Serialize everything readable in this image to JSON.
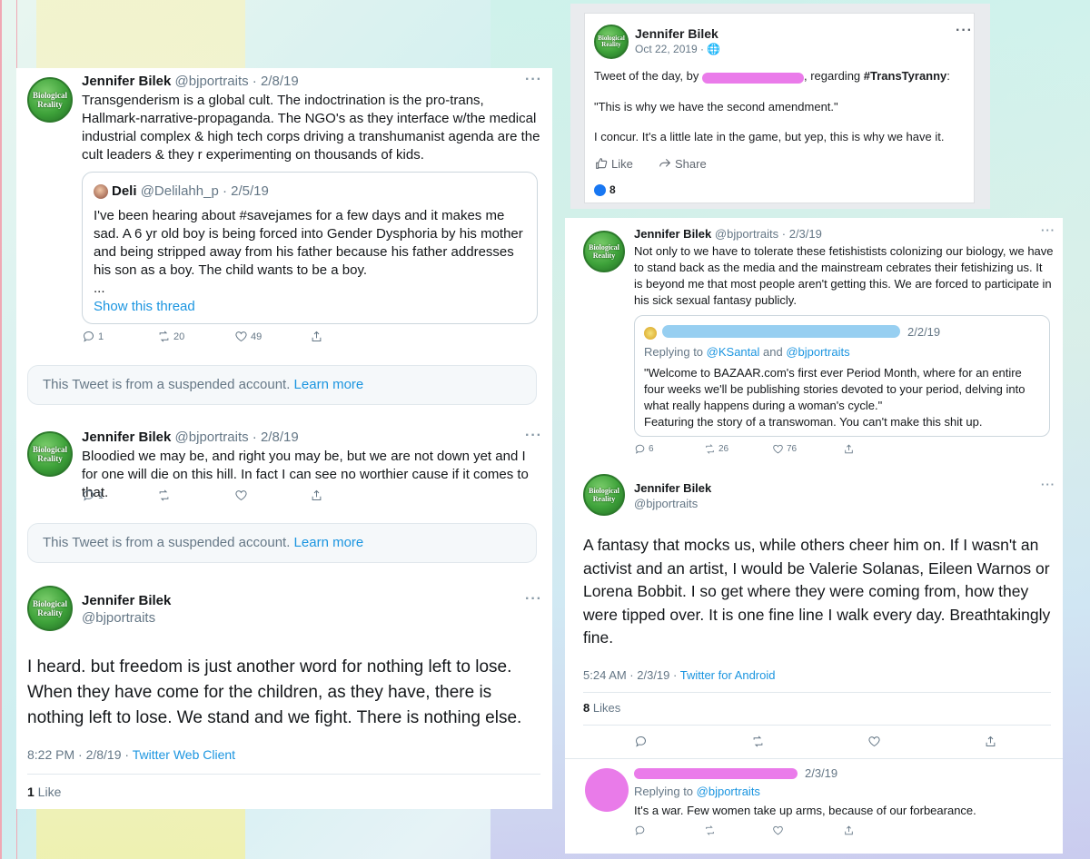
{
  "left": {
    "t1": {
      "name": "Jennifer Bilek",
      "handle": "@bjportraits · 2/8/19",
      "text": "Transgenderism is a global cult.  The indoctrination is the pro-trans, Hallmark-narrative-propaganda.  The NGO's as they interface w/the medical industrial complex & high tech corps driving a transhumanist agenda are the cult leaders & they r experimenting on thousands of kids.",
      "quote": {
        "name": "Deli",
        "handle": "@Delilahh_p · 2/5/19",
        "text": "I've been hearing about #savejames for a few days and it makes me sad. A 6 yr old boy is being forced into Gender Dysphoria by his mother and being stripped away from his father because his father addresses his son as a boy. The child wants to be a boy.",
        "ellipsis": "...",
        "show_thread": "Show this thread"
      },
      "replies": "1",
      "retweets": "20",
      "likes": "49"
    },
    "suspended1": {
      "text": "This Tweet is from a suspended account.",
      "link": "Learn more"
    },
    "t2": {
      "name": "Jennifer Bilek",
      "handle": "@bjportraits · 2/8/19",
      "text": "Bloodied we may be, and right you may be, but we are not down yet and I for one will die on this hill.  In fact I can see no worthier cause if it comes to that.",
      "replies": "1"
    },
    "suspended2": {
      "text": "This Tweet is from a suspended account.",
      "link": "Learn more"
    },
    "t3": {
      "name": "Jennifer Bilek",
      "handle": "@bjportraits",
      "text": "I heard.  but freedom is just another word for nothing left to lose. When they have come for the children, as they have, there is nothing left to lose.  We stand and we fight.  There is nothing else.",
      "time": "8:22 PM · 2/8/19 · ",
      "client": "Twitter Web Client",
      "likes_count": "1",
      "likes_label": " Like"
    }
  },
  "fb": {
    "name": "Jennifer Bilek",
    "date": "Oct 22, 2019 · ",
    "line1_pre": "Tweet of the day, by ",
    "line1_mid": ", regarding ",
    "hashtag": "#TransTyranny",
    "line1_post": ":",
    "quote": "\"This is why we have the second amendment.\"",
    "concur": "I concur.  It's a little late in the game, but yep, this is why we have it.",
    "like": "Like",
    "share": "Share",
    "reactions": "8"
  },
  "right": {
    "t1": {
      "name": "Jennifer Bilek",
      "handle": "@bjportraits · 2/3/19",
      "text": "Not only to we have to tolerate these fetishistists colonizing our biology, we have to stand back as the media and the mainstream cebrates their fetishizing us. It is beyond me that most people aren't getting this. We are forced to participate in his sick sexual fantasy publicly.",
      "quote": {
        "date": "2/2/19",
        "replying": "Replying to ",
        "r1": "@KSantal",
        "and": " and ",
        "r2": "@bjportraits",
        "text": "\"Welcome to BAZAAR.com's first ever Period Month, where for an entire four weeks we'll be publishing stories devoted to your period, delving into what really happens during a woman's cycle.\"",
        "text2": "Featuring the story of a transwoman. You can't make this shit up."
      },
      "replies": "6",
      "retweets": "26",
      "likes": "76"
    },
    "t2": {
      "name": "Jennifer Bilek",
      "handle": "@bjportraits",
      "text": "A fantasy that mocks us, while others cheer him on. If I wasn't an activist and an artist, I would be Valerie Solanas, Eileen Warnos or Lorena Bobbit. I so get where they were coming from, how they were tipped over.  It is one fine line I walk every day. Breathtakingly fine.",
      "time": "5:24 AM · 2/3/19 · ",
      "client": "Twitter for Android",
      "likes_count": "8",
      "likes_label": " Likes"
    },
    "t3": {
      "date": "2/3/19",
      "replying": "Replying to ",
      "r1": "@bjportraits",
      "text": "It's a war. Few women take up arms, because of our forbearance."
    }
  },
  "avatar_text": [
    "Biological",
    "Reality"
  ],
  "dots": "···"
}
